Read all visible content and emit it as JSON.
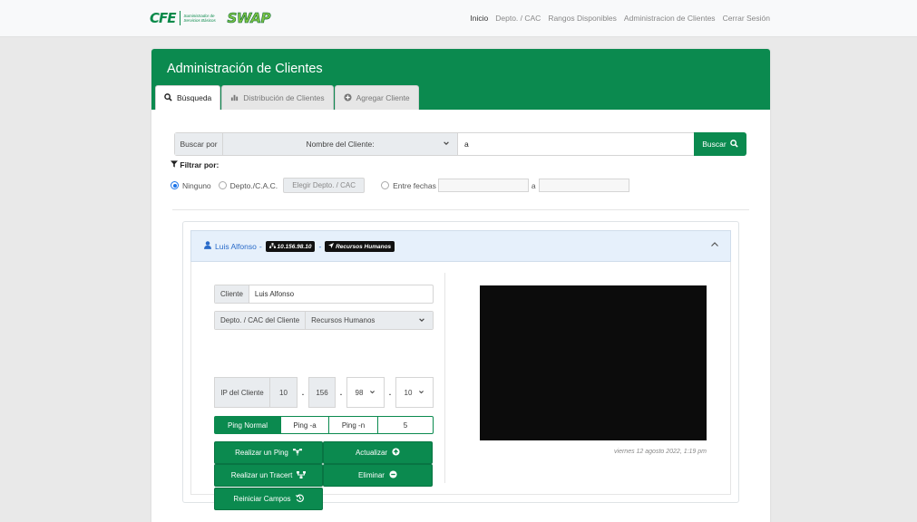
{
  "nav": {
    "logo_cfe": "CFE",
    "logo_subtitle": "Suministrador de Servicios Básicos",
    "logo_swap": "SWAP",
    "links": [
      "Inicio",
      "Depto. / CAC",
      "Rangos Disponibles",
      "Administracion de Clientes",
      "Cerrar Sesión"
    ]
  },
  "page": {
    "title": "Administración de Clientes",
    "tabs": [
      "Búsqueda",
      "Distribución de Clientes",
      "Agregar Cliente"
    ]
  },
  "search": {
    "label": "Buscar por",
    "field": "Nombre del Cliente:",
    "value": "a",
    "button": "Buscar"
  },
  "filter": {
    "label": "Filtrar por:",
    "options": [
      "Ninguno",
      "Depto./C.A.C.",
      "Entre fechas"
    ],
    "depto_placeholder": "Elegir Depto. / CAC",
    "date_sep": "a"
  },
  "client": {
    "name": "Luis Alfonso",
    "sep": "-",
    "ip_chip": "10.156.98.10",
    "dept_chip": "Recursos Humanos",
    "field_label_client": "Cliente",
    "field_value_client": "Luis Alfonso",
    "field_label_dept": "Depto. / CAC del Cliente",
    "field_value_dept": "Recursos Humanos",
    "field_label_ip": "IP del Cliente",
    "ip": [
      "10",
      "156",
      "98",
      "10"
    ],
    "ip_dot": ".",
    "ping_options": [
      "Ping Normal",
      "Ping -a",
      "Ping -n",
      "5"
    ],
    "buttons": {
      "ping": "Realizar un Ping",
      "update": "Actualizar",
      "tracert": "Realizar un Tracert",
      "delete": "Eliminar",
      "reset": "Reiniciar Campos"
    },
    "timestamp": "viernes 12 agosto 2022, 1:19 pm"
  },
  "colors": {
    "brand_green": "#0b8a4f",
    "link_blue": "#2a6bc9"
  }
}
